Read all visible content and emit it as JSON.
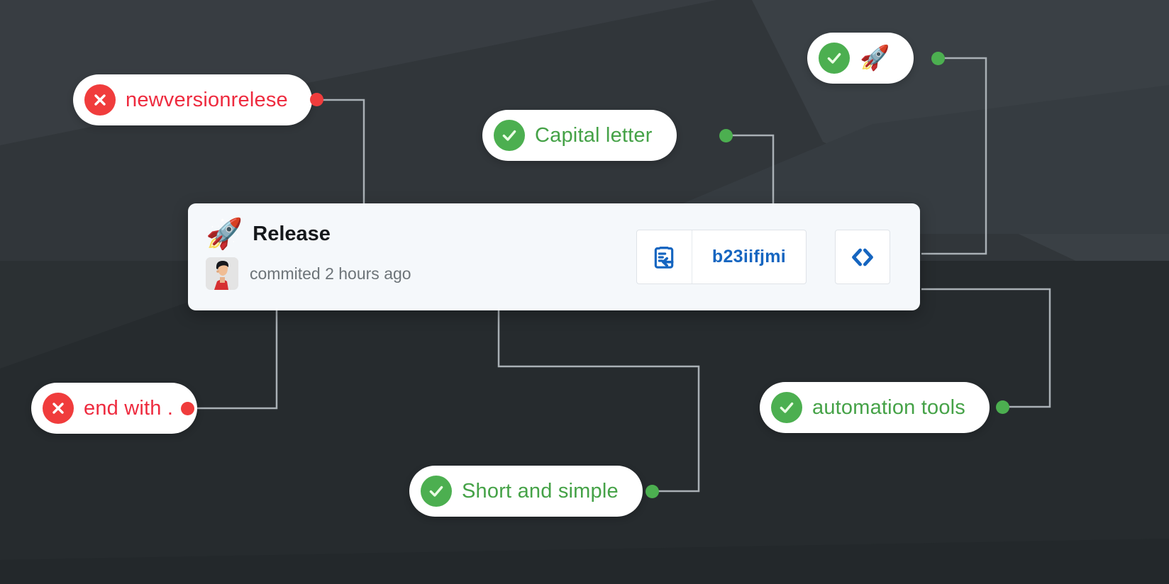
{
  "theme": {
    "background": "#31363a",
    "background_dark": "#262b2e",
    "card_background": "#f5f8fb",
    "accent_blue": "#1565c0",
    "good_green": "#4caf50",
    "good_text": "#45a247",
    "bad_red": "#f03c3c",
    "bad_text": "#ee2b3f",
    "wire_color": "#a9b0b5"
  },
  "commit_card": {
    "rocket_emoji": "🚀",
    "title": "Release",
    "meta": "commited 2 hours ago",
    "avatar_name": "user-avatar",
    "copy_icon": "clipboard-paste-icon",
    "hash": "b23iifjmi",
    "code_icon": "code-brackets-icon"
  },
  "annotations": [
    {
      "id": "newversionrelese",
      "label": "newversionrelese",
      "status": "bad",
      "icon": "x-circle-icon",
      "emoji": null,
      "node_side": "right"
    },
    {
      "id": "capital-letter",
      "label": "Capital letter",
      "status": "good",
      "icon": "check-circle-icon",
      "emoji": null,
      "node_side": "right"
    },
    {
      "id": "rocket-emoji-rule",
      "label": "",
      "status": "good",
      "icon": "check-circle-icon",
      "emoji": "🚀",
      "node_side": "right"
    },
    {
      "id": "end-with-period",
      "label": "end with .",
      "status": "bad",
      "icon": "x-circle-icon",
      "emoji": null,
      "node_side": "right"
    },
    {
      "id": "automation-tools",
      "label": "automation tools",
      "status": "good",
      "icon": "check-circle-icon",
      "emoji": null,
      "node_side": "right"
    },
    {
      "id": "short-and-simple",
      "label": "Short and simple",
      "status": "good",
      "icon": "check-circle-icon",
      "emoji": null,
      "node_side": "right"
    }
  ]
}
